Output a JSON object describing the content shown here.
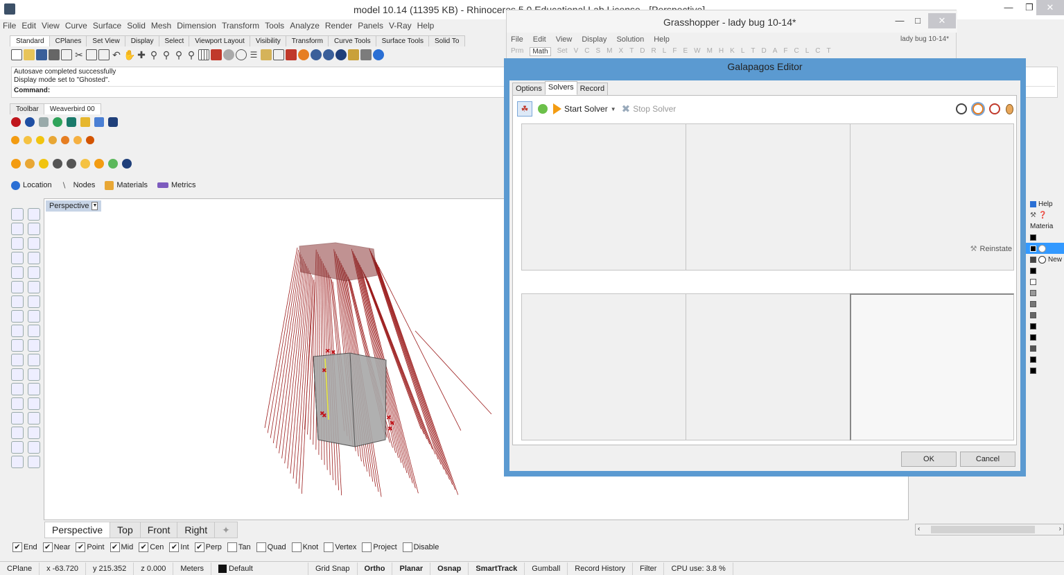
{
  "rhino": {
    "title": "model 10.14 (11395 KB) - Rhinoceros 5.0 Educational Lab License - [Perspective]",
    "menu": [
      "File",
      "Edit",
      "View",
      "Curve",
      "Surface",
      "Solid",
      "Mesh",
      "Dimension",
      "Transform",
      "Tools",
      "Analyze",
      "Render",
      "Panels",
      "V-Ray",
      "Help"
    ],
    "toolbar_tabs": [
      "Standard",
      "CPlanes",
      "Set View",
      "Display",
      "Select",
      "Viewport Layout",
      "Visibility",
      "Transform",
      "Curve Tools",
      "Surface Tools",
      "Solid To"
    ],
    "command_history": [
      "Autosave completed successfully",
      "Display mode set to \"Ghosted\"."
    ],
    "command_label": "Command:",
    "secondary_tabs": [
      "Toolbar",
      "Weaverbird 00"
    ],
    "named_items": [
      {
        "label": "Location",
        "icon": "globe-icon"
      },
      {
        "label": "Nodes",
        "icon": "nodes-icon"
      },
      {
        "label": "Materials",
        "icon": "materials-icon"
      },
      {
        "label": "Metrics",
        "icon": "ruler-icon"
      }
    ],
    "viewport_label": "Perspective",
    "viewport_tabs": [
      "Perspective",
      "Top",
      "Front",
      "Right"
    ],
    "osnaps": [
      {
        "label": "End",
        "checked": true
      },
      {
        "label": "Near",
        "checked": true
      },
      {
        "label": "Point",
        "checked": true
      },
      {
        "label": "Mid",
        "checked": true
      },
      {
        "label": "Cen",
        "checked": true
      },
      {
        "label": "Int",
        "checked": true
      },
      {
        "label": "Perp",
        "checked": true
      },
      {
        "label": "Tan",
        "checked": false
      },
      {
        "label": "Quad",
        "checked": false
      },
      {
        "label": "Knot",
        "checked": false
      },
      {
        "label": "Vertex",
        "checked": false
      },
      {
        "label": "Project",
        "checked": false
      },
      {
        "label": "Disable",
        "checked": false
      }
    ],
    "status": {
      "cplane": "CPlane",
      "x": "x -63.720",
      "y": "y 215.352",
      "z": "z 0.000",
      "units": "Meters",
      "layer": "Default",
      "items": [
        "Grid Snap",
        "Ortho",
        "Planar",
        "Osnap",
        "SmartTrack",
        "Gumball",
        "Record History",
        "Filter",
        "CPU use: 3.8 %"
      ]
    },
    "right_panel": {
      "help": "Help",
      "material_header": "Materia",
      "new_label": "New"
    }
  },
  "grasshopper": {
    "title": "Grasshopper - lady bug 10-14*",
    "doc_name": "lady bug 10-14*",
    "menu": [
      "File",
      "Edit",
      "View",
      "Display",
      "Solution",
      "Help"
    ],
    "tabs": [
      "Prm",
      "Math",
      "Set",
      "V",
      "C",
      "S",
      "M",
      "X",
      "T",
      "D",
      "R",
      "L",
      "F",
      "E",
      "W",
      "M",
      "H",
      "K",
      "L",
      "T",
      "D",
      "A",
      "F",
      "C",
      "L",
      "C",
      "T"
    ],
    "active_tab": "Math"
  },
  "galapagos": {
    "title": "Galapagos Editor",
    "tabs": [
      "Options",
      "Solvers",
      "Record"
    ],
    "active_tab": "Solvers",
    "start_label": "Start Solver",
    "stop_label": "Stop Solver",
    "reinstate_label": "Reinstate",
    "ok_label": "OK",
    "cancel_label": "Cancel"
  },
  "colors": {
    "accent": "#5b9ad1",
    "ray": "#9b1b1b",
    "selection": "#3399ff"
  }
}
